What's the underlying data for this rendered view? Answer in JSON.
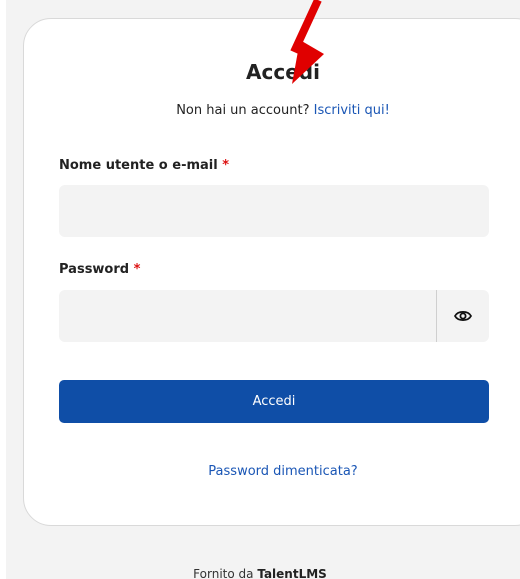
{
  "login": {
    "title": "Accedi",
    "no_account_text": "Non hai un account?",
    "signup_link": "Iscriviti qui!",
    "username_label": "Nome utente o e-mail",
    "password_label": "Password",
    "required_mark": "*",
    "username_value": "",
    "password_value": "",
    "submit_label": "Accedi",
    "forgot_link": "Password dimenticata?"
  },
  "footer": {
    "powered_by": "Fornito da",
    "brand": "TalentLMS"
  },
  "colors": {
    "primary_button": "#0f4ea7",
    "link": "#1a56b5",
    "required": "#dd1111",
    "arrow": "#e00000"
  },
  "icons": {
    "password_toggle": "eye-icon",
    "annotation": "red-arrow-icon"
  }
}
